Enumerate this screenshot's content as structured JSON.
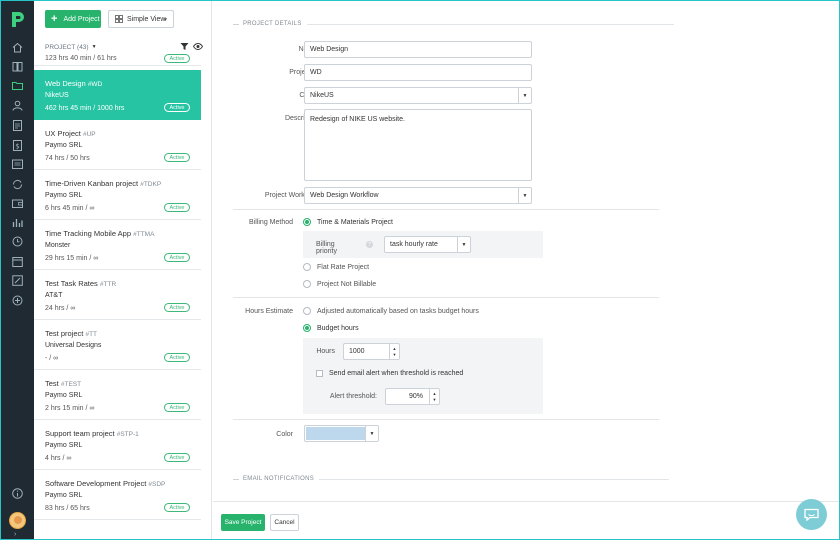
{
  "nav": {
    "icons": [
      "home-icon",
      "book-icon",
      "folder-icon",
      "user-icon",
      "document-icon",
      "dollar-icon",
      "presentation-icon",
      "sync-icon",
      "wallet-icon",
      "bar-chart-icon",
      "clock-icon",
      "calendar-icon",
      "edit-icon",
      "add-circle-icon",
      "info-icon"
    ]
  },
  "toolbar": {
    "add_label": "Add Project",
    "view_label": "Simple View"
  },
  "list": {
    "header": "PROJECT (43)",
    "partial_hours": "123 hrs 40 min / 61 hrs",
    "partial_status": "Active",
    "projects": [
      {
        "title": "Web Design",
        "code": "#WD",
        "client": "NikeUS",
        "hours": "462 hrs 45 min / 1000 hrs",
        "status": "Active"
      },
      {
        "title": "UX Project",
        "code": "#UP",
        "client": "Paymo SRL",
        "hours": "74 hrs / 50 hrs",
        "status": "Active"
      },
      {
        "title": "Time-Driven Kanban project",
        "code": "#TDKP",
        "client": "Paymo SRL",
        "hours": "6 hrs 45 min / ∞",
        "status": "Active"
      },
      {
        "title": "Time Tracking Mobile App",
        "code": "#TTMA",
        "client": "Monster",
        "hours": "29 hrs 15 min / ∞",
        "status": "Active"
      },
      {
        "title": "Test Task Rates",
        "code": "#TTR",
        "client": "AT&T",
        "hours": "24 hrs / ∞",
        "status": "Active"
      },
      {
        "title": "Test project",
        "code": "#TT",
        "client": "Universal Designs",
        "hours": "- / ∞",
        "status": "Active"
      },
      {
        "title": "Test",
        "code": "#TEST",
        "client": "Paymo SRL",
        "hours": "2 hrs 15 min / ∞",
        "status": "Active"
      },
      {
        "title": "Support team project",
        "code": "#STP-1",
        "client": "Paymo SRL",
        "hours": "4 hrs / ∞",
        "status": "Active"
      },
      {
        "title": "Software Development Project",
        "code": "#SDP",
        "client": "Paymo SRL",
        "hours": "83 hrs / 65 hrs",
        "status": "Active"
      }
    ]
  },
  "form": {
    "section_details": "PROJECT DETAILS",
    "name_label": "Name",
    "name_value": "Web Design",
    "id_label": "Project ID",
    "id_value": "WD",
    "client_label": "Client",
    "client_value": "NikeUS",
    "description_label": "Description",
    "description_value": "Redesign of NIKE US website.",
    "workflow_label": "Project Workflow",
    "workflow_value": "Web Design Workflow",
    "billing_label": "Billing Method",
    "billing_tm": "Time & Materials Project",
    "billing_priority_label": "Billing priority",
    "billing_priority_value": "task hourly rate",
    "billing_flat": "Flat Rate Project",
    "billing_not": "Project Not Billable",
    "hours_label": "Hours Estimate",
    "hours_auto": "Adjusted automatically based on tasks budget hours",
    "hours_budget": "Budget hours",
    "hours_field_label": "Hours",
    "hours_value": "1000",
    "email_alert": "Send email alert when threshold is reached",
    "threshold_label": "Alert threshold:",
    "threshold_value": "90%",
    "color_label": "Color",
    "color_value": "#bdd7ec",
    "section_email": "EMAIL NOTIFICATIONS",
    "required_mark": "*"
  },
  "footer": {
    "save_label": "Save Project",
    "cancel_label": "Cancel"
  },
  "colors": {
    "accent": "#27b36c",
    "selected": "#27c4a4",
    "nav_bg": "#1f2a33"
  }
}
